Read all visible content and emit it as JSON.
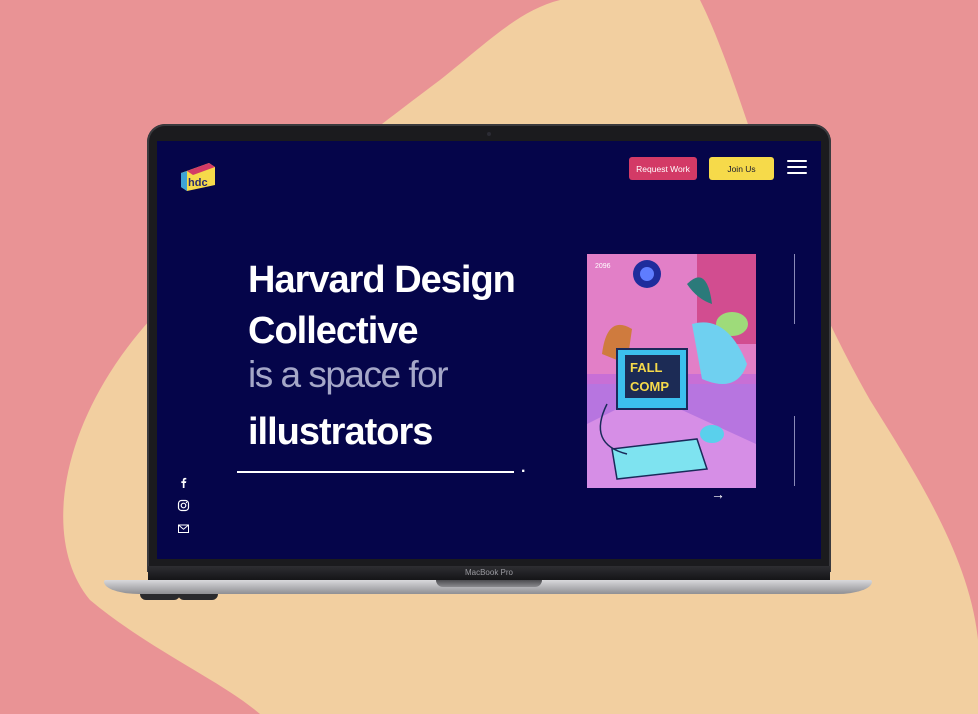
{
  "brand": {
    "logo_text": "hdc",
    "accent": "#d33a66",
    "highlight": "#f6da4a",
    "background": "#05054a"
  },
  "header": {
    "request_label": "Request Work",
    "join_label": "Join Us",
    "menu_icon": "hamburger-icon"
  },
  "hero": {
    "title_line1": "Harvard Design",
    "title_line2": "Collective",
    "subtitle": "is a space for",
    "rotating_word": "illustrators",
    "period": "."
  },
  "social": {
    "icons": [
      "facebook-icon",
      "instagram-icon",
      "mail-icon"
    ]
  },
  "artwork": {
    "text_top": "FALL",
    "text_bottom": "COMP",
    "year": "2096"
  },
  "device": {
    "label": "MacBook Pro"
  }
}
